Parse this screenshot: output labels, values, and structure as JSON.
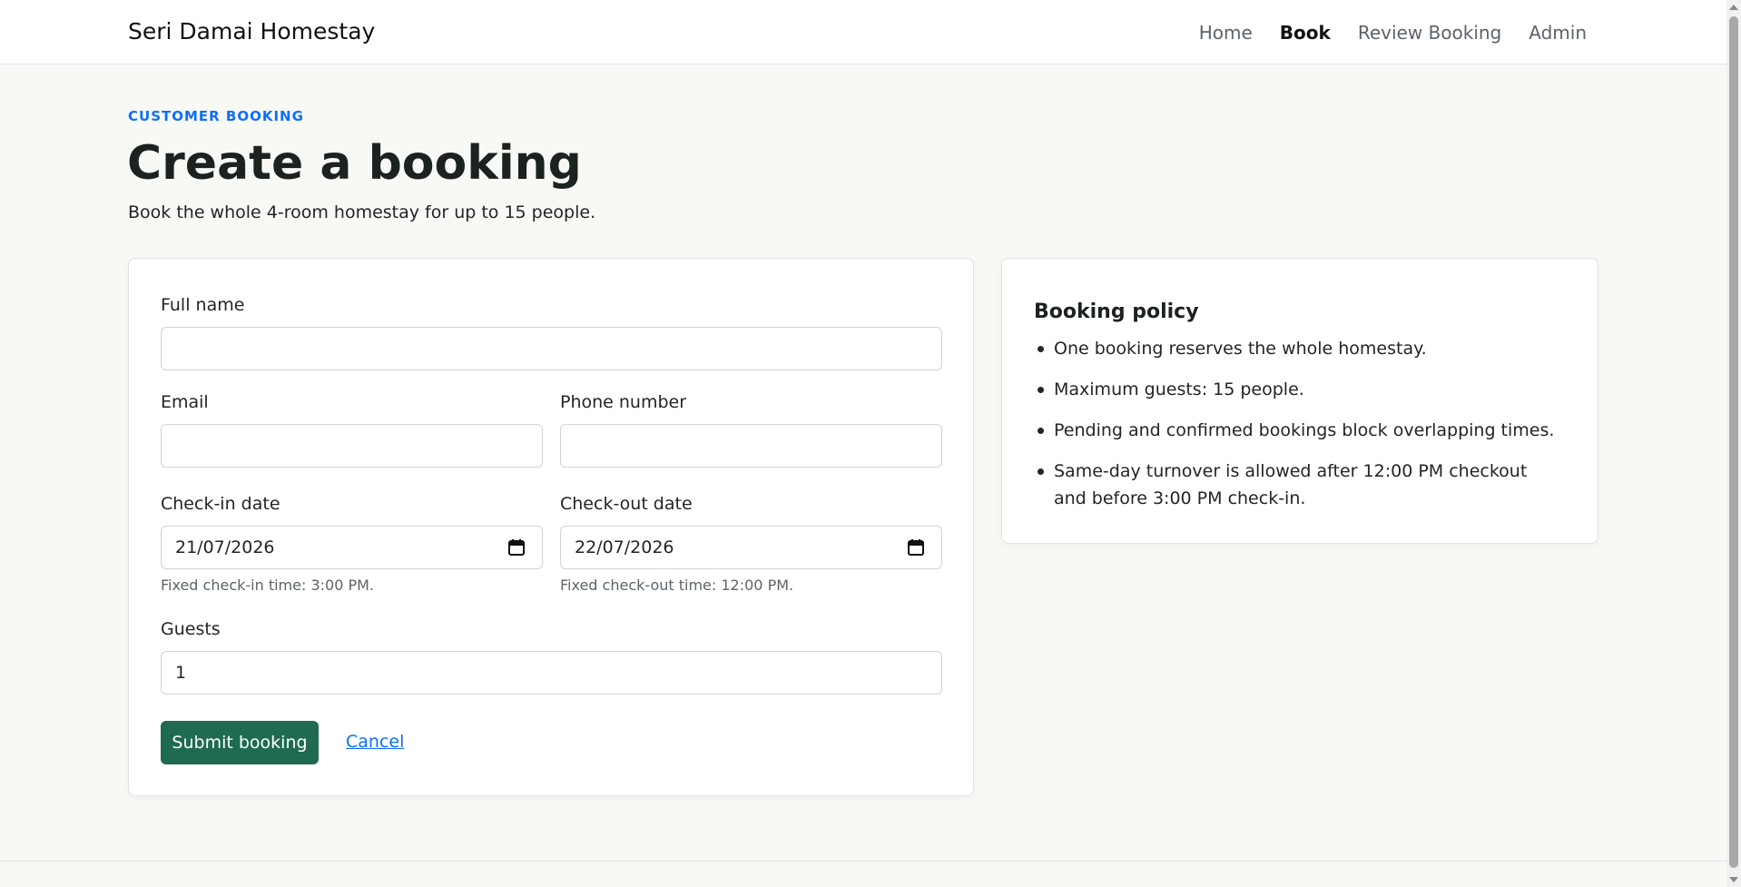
{
  "navbar": {
    "brand": "Seri Damai Homestay",
    "links": [
      {
        "label": "Home",
        "active": false
      },
      {
        "label": "Book",
        "active": true
      },
      {
        "label": "Review Booking",
        "active": false
      },
      {
        "label": "Admin",
        "active": false
      }
    ]
  },
  "header": {
    "eyebrow": "CUSTOMER BOOKING",
    "title": "Create a booking",
    "subtitle": "Book the whole 4-room homestay for up to 15 people."
  },
  "form": {
    "full_name_label": "Full name",
    "full_name_value": "",
    "email_label": "Email",
    "email_value": "",
    "phone_label": "Phone number",
    "phone_value": "",
    "checkin_label": "Check-in date",
    "checkin_value": "21/07/2026",
    "checkin_hint": "Fixed check-in time: 3:00 PM.",
    "checkout_label": "Check-out date",
    "checkout_value": "22/07/2026",
    "checkout_hint": "Fixed check-out time: 12:00 PM.",
    "guests_label": "Guests",
    "guests_value": "1",
    "submit_label": "Submit booking",
    "cancel_label": "Cancel"
  },
  "policy": {
    "title": "Booking policy",
    "items": [
      "One booking reserves the whole homestay.",
      "Maximum guests: 15 people.",
      "Pending and confirmed bookings block overlapping times.",
      "Same-day turnover is allowed after 12:00 PM checkout and before 3:00 PM check-in."
    ]
  },
  "colors": {
    "accent": "#0d6efd",
    "primary_button": "#1e6b4f",
    "background": "#f8f9f5"
  },
  "icons": {
    "date_picker": "calendar-icon"
  }
}
